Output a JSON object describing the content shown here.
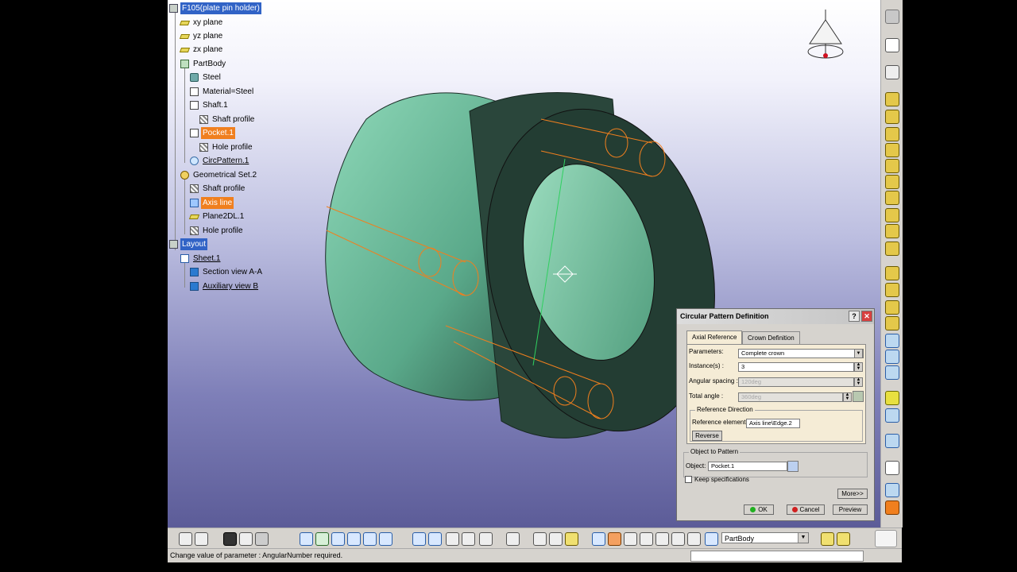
{
  "tree": {
    "root": "F105(plate pin holder)",
    "items": [
      {
        "label": "xy plane",
        "icon": "plane"
      },
      {
        "label": "yz plane",
        "icon": "plane"
      },
      {
        "label": "zx plane",
        "icon": "plane"
      },
      {
        "label": "PartBody",
        "icon": "body"
      },
      {
        "label": "Steel",
        "icon": "mat"
      },
      {
        "label": "Material=Steel",
        "icon": "feat"
      },
      {
        "label": "Shaft.1",
        "icon": "feat"
      },
      {
        "label": "Shaft profile",
        "icon": "sketch"
      },
      {
        "label": "Pocket.1",
        "icon": "feat"
      },
      {
        "label": "Hole profile",
        "icon": "sketch"
      },
      {
        "label": "CircPattern.1",
        "icon": "pattern"
      },
      {
        "label": "Geometrical Set.2",
        "icon": "geo"
      },
      {
        "label": "Shaft profile",
        "icon": "sketch"
      },
      {
        "label": "Axis line",
        "icon": "axis"
      },
      {
        "label": "Plane2DL.1",
        "icon": "plane"
      },
      {
        "label": "Hole profile",
        "icon": "sketch"
      },
      {
        "label": "Layout",
        "icon": "root"
      },
      {
        "label": "Sheet.1",
        "icon": "sheet"
      },
      {
        "label": "Section view A-A",
        "icon": "view"
      },
      {
        "label": "Auxiliary view B",
        "icon": "view"
      }
    ]
  },
  "dialog": {
    "title": "Circular Pattern Definition",
    "help": "?",
    "close": "✕",
    "tabs": [
      "Axial Reference",
      "Crown Definition"
    ],
    "parameters_label": "Parameters:",
    "parameters_value": "Complete crown",
    "instances_label": "Instance(s) :",
    "instances_value": "3",
    "angular_spacing_label": "Angular spacing :",
    "angular_spacing_value": "120deg",
    "total_angle_label": "Total angle :",
    "total_angle_value": "360deg",
    "reference_direction": "Reference Direction",
    "reference_element_label": "Reference element:",
    "reference_element_value": "Axis line\\Edge.2",
    "reverse_label": "Reverse",
    "object_to_pattern": "Object to Pattern",
    "object_label": "Object:",
    "object_value": "Pocket.1",
    "keep_specs_label": "Keep specifications",
    "more_label": "More>>",
    "ok_label": "OK",
    "cancel_label": "Cancel",
    "preview_label": "Preview"
  },
  "toolbar": {
    "body_select": "PartBody"
  },
  "status": {
    "message": "Change value of parameter : AngularNumber required."
  },
  "colors": {
    "tree_selected": "#3163c6",
    "tree_highlight": "#f07f1e",
    "part_face": "#5fae8e",
    "part_dark": "#1f3a30",
    "wireframe": "#f07f1e"
  }
}
